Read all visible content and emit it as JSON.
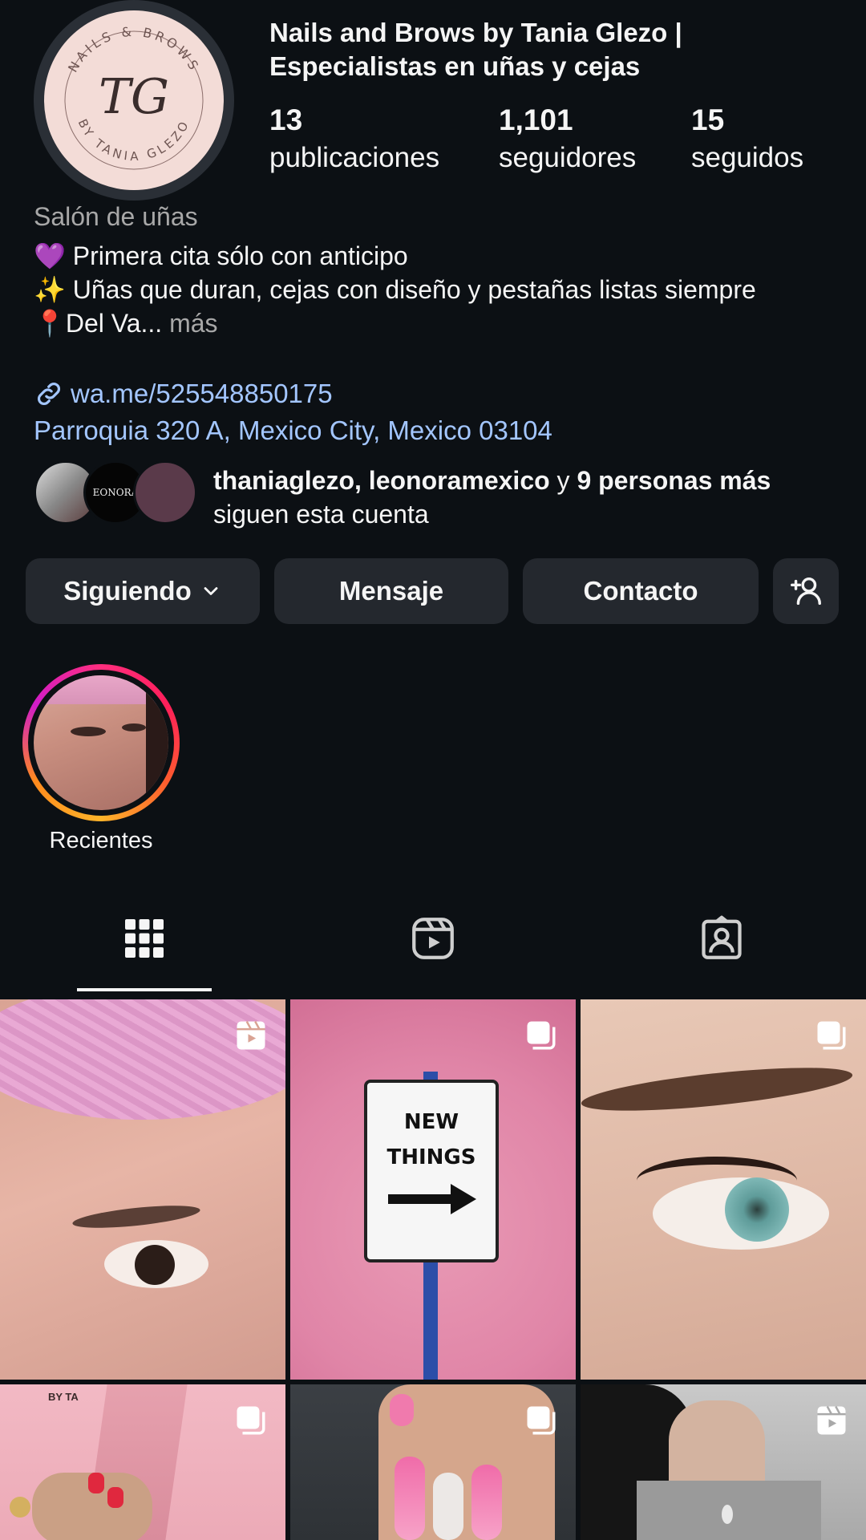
{
  "profile": {
    "name": "Nails and Brows by Tania Glezo | Especialistas en uñas y cejas",
    "avatar_monogram": "TG",
    "avatar_ring_text_top": "NAILS & BROWS",
    "avatar_ring_text_bottom": "BY TANIA GLEZO"
  },
  "stats": [
    {
      "value": "13",
      "label": "publicaciones"
    },
    {
      "value": "1,101",
      "label": "seguidores"
    },
    {
      "value": "15",
      "label": "seguidos"
    }
  ],
  "category": "Salón de uñas",
  "bio": {
    "line1": "💜 Primera cita sólo con anticipo",
    "line2": "✨ Uñas que duran, cejas con diseño y pestañas listas siempre",
    "line3": "📍Del Va...",
    "more": "más"
  },
  "link": "wa.me/525548850175",
  "address": "Parroquia 320 A, Mexico City, Mexico 03104",
  "followed_by": {
    "names": "thaniaglezo, leonoramexico",
    "connector": "y",
    "others": "9 personas más",
    "suffix": "siguen esta cuenta",
    "avatar2_text": "EONORA"
  },
  "buttons": {
    "following": "Siguiendo",
    "message": "Mensaje",
    "contact": "Contacto"
  },
  "highlights": [
    {
      "label": "Recientes"
    }
  ],
  "tabs": [
    "grid",
    "reels",
    "tagged"
  ],
  "grid": [
    {
      "badge": "reel-icon"
    },
    {
      "badge": "carousel-icon",
      "sign_line1": "NEW",
      "sign_line2": "THINGS"
    },
    {
      "badge": "carousel-icon"
    },
    {
      "badge": "carousel-icon",
      "corner_text": "BY TA"
    },
    {
      "badge": "carousel-icon"
    },
    {
      "badge": "reel-icon"
    }
  ],
  "colors": {
    "background": "#0c1014",
    "button": "#24282e",
    "link": "#a3c6ff",
    "muted": "#a8a8a8"
  }
}
